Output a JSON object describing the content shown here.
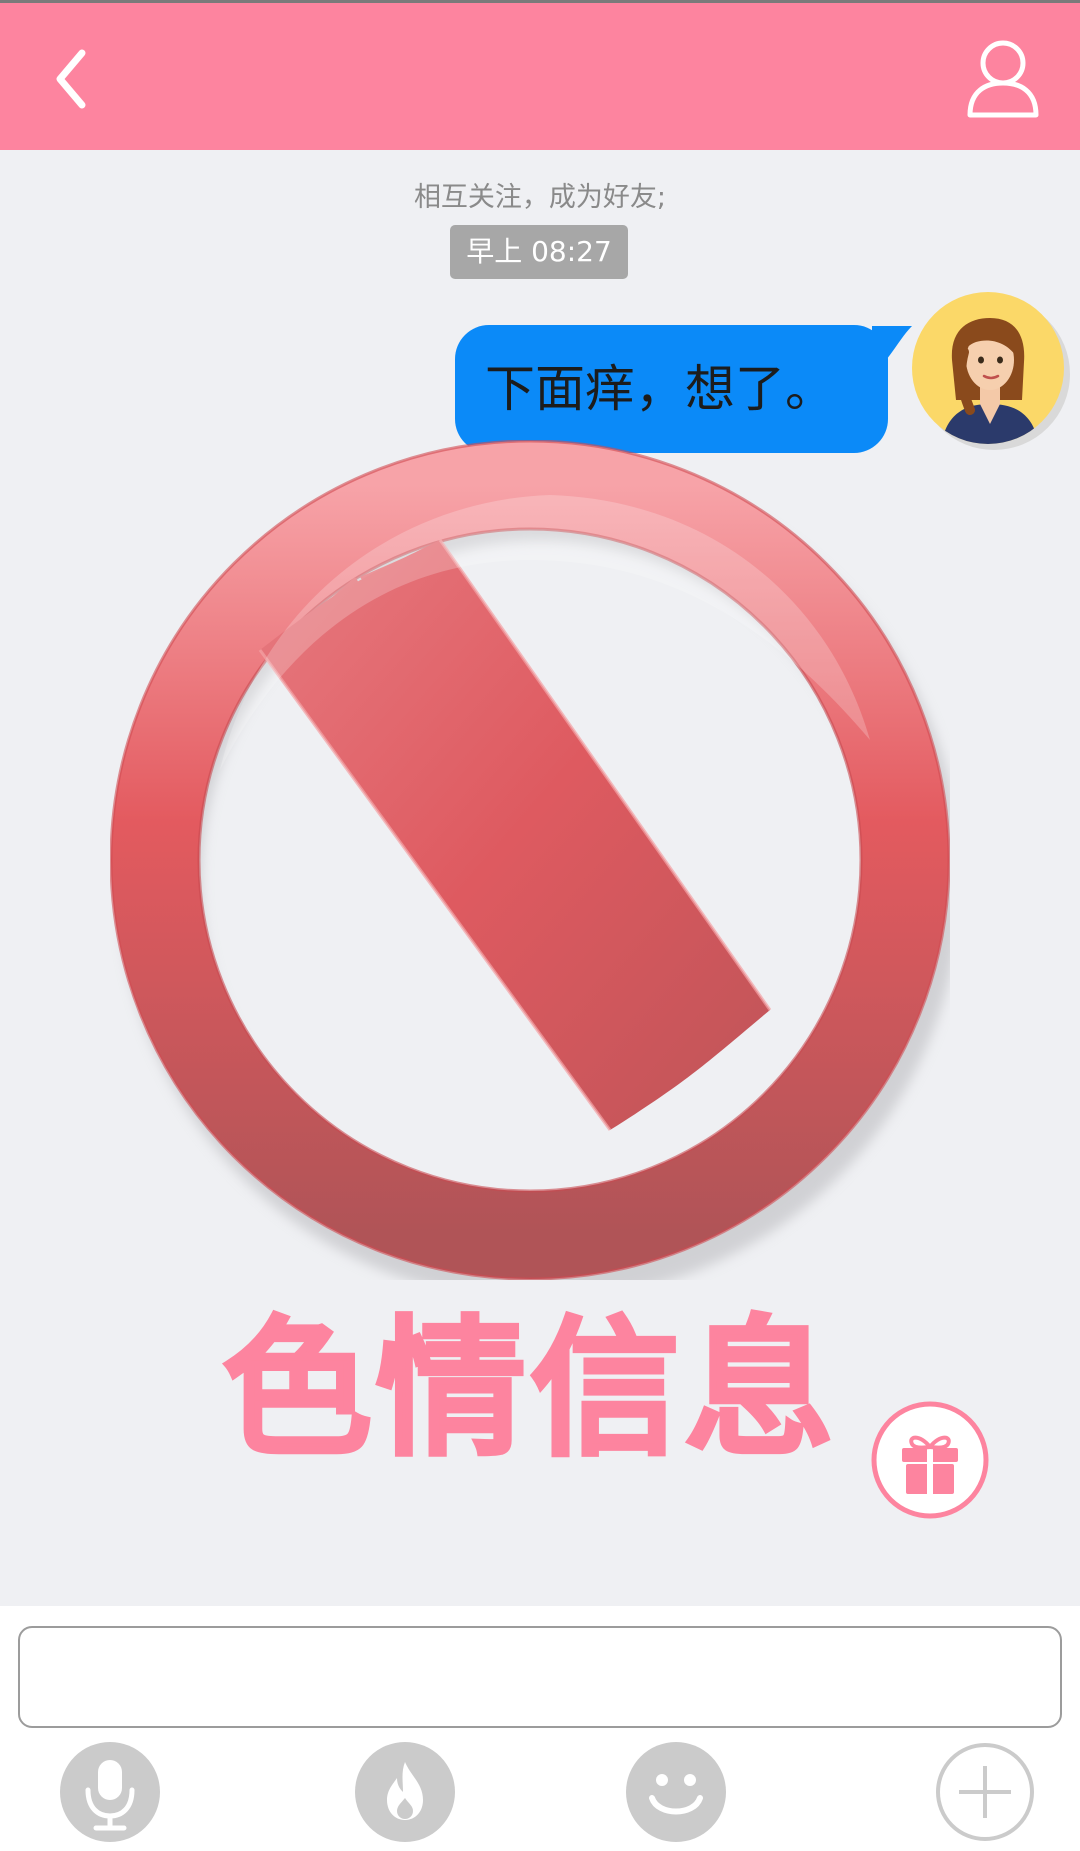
{
  "header": {
    "back_icon": "chevron-left-icon",
    "profile_icon": "person-outline-icon",
    "background_color": "#fd849f"
  },
  "chat": {
    "notice": "相互关注，成为好友;",
    "timestamp": "早上 08:27",
    "message": {
      "text": "下面痒，想了。",
      "bubble_color": "#0b8af8",
      "sender_avatar": "woman-avatar-icon"
    },
    "overlay": {
      "icon": "prohibited-sign-icon",
      "label": "色情信息",
      "label_color": "#fd849f"
    },
    "gift_icon": "gift-icon"
  },
  "input_bar": {
    "input_value": "",
    "tools": [
      {
        "name": "microphone-icon"
      },
      {
        "name": "flame-icon"
      },
      {
        "name": "smiley-icon"
      },
      {
        "name": "plus-icon"
      }
    ]
  }
}
